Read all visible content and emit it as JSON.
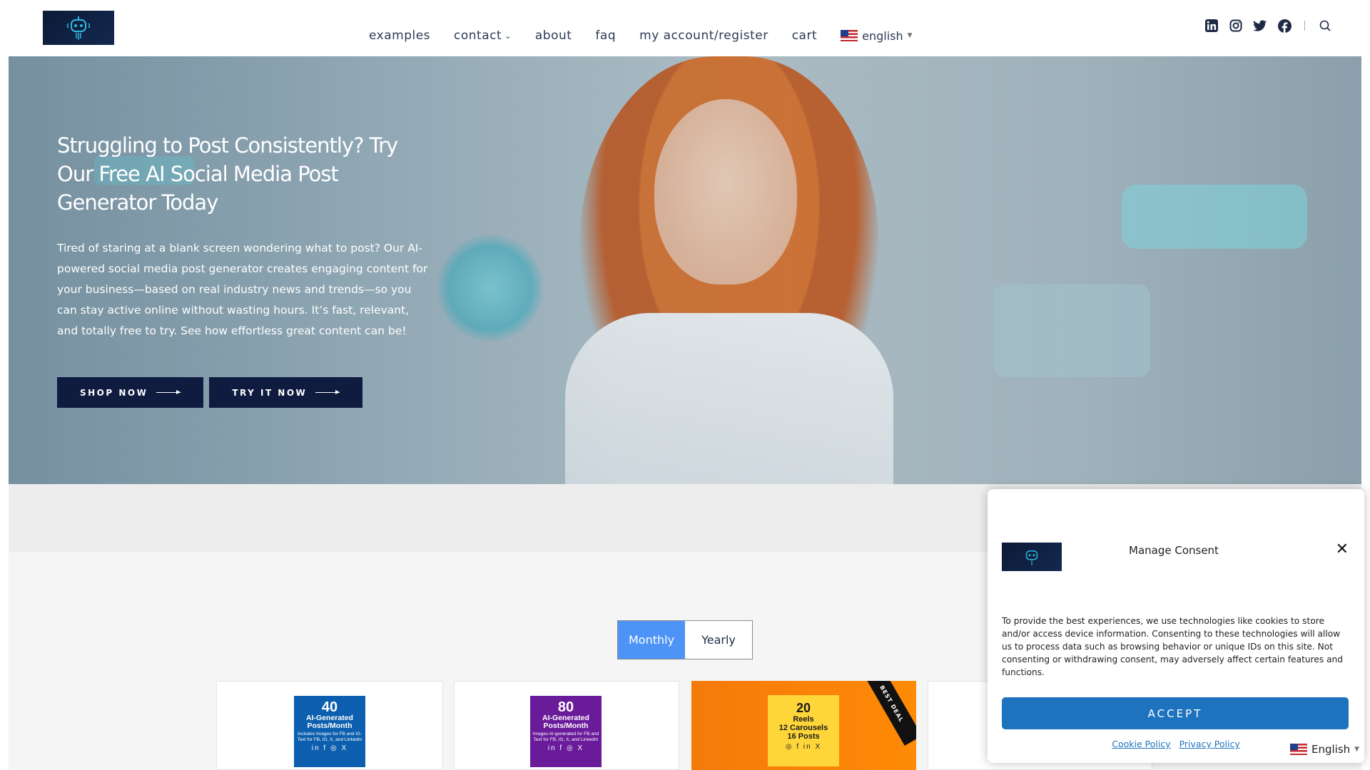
{
  "header": {
    "nav": [
      {
        "label": "examples",
        "has_dropdown": false
      },
      {
        "label": "contact",
        "has_dropdown": true
      },
      {
        "label": "about",
        "has_dropdown": false
      },
      {
        "label": "faq",
        "has_dropdown": false
      },
      {
        "label": "my account/register",
        "has_dropdown": false
      },
      {
        "label": "cart",
        "has_dropdown": false
      }
    ],
    "language": "english",
    "social_icons": [
      "linkedin-icon",
      "instagram-icon",
      "twitter-icon",
      "facebook-icon",
      "search-icon"
    ]
  },
  "hero": {
    "title": "Struggling to Post Consistently? Try Our Free AI Social Media Post Generator Today",
    "description": "Tired of staring at a blank screen wondering what to post? Our AI-powered social media post generator creates engaging content for your business—based on real industry news and trends—so you can stay active online without wasting hours. It’s fast, relevant, and totally free to try. See how effortless great content can be!",
    "shop_button": "SHOP NOW",
    "try_button": "TRY IT NOW"
  },
  "pricing": {
    "toggle": {
      "monthly": "Monthly",
      "yearly": "Yearly",
      "selected": "Monthly"
    },
    "cards": [
      {
        "big": "40",
        "mid": "AI-Generated Posts/Month",
        "small": "Includes Images for FB and IG. Text for FB, IG, X, and LinkedIn",
        "color": "#0c5fae"
      },
      {
        "big": "80",
        "mid": "AI-Generated Posts/Month",
        "small": "Images AI-generated for FB and Text for FB, IG, X, and LinkedIn",
        "color": "#6a1b9a"
      },
      {
        "big": "20",
        "mid1": "Reels",
        "mid2": "12 Carousels",
        "mid3": "16 Posts",
        "ribbon": "BEST DEAL",
        "color": "#ffd63a"
      }
    ]
  },
  "consent": {
    "title": "Manage Consent",
    "text": "To provide the best experiences, we use technologies like cookies to store and/or access device information. Consenting to these technologies will allow us to process data such as browsing behavior or unique IDs on this site. Not consenting or withdrawing consent, may adversely affect certain features and functions.",
    "accept": "ACCEPT",
    "cookie_policy": "Cookie Policy",
    "privacy_policy": "Privacy Policy",
    "language": "English"
  },
  "colors": {
    "navy": "#0f1c3f",
    "accent_blue": "#1e73be",
    "toggle_blue": "#4d94f6"
  }
}
